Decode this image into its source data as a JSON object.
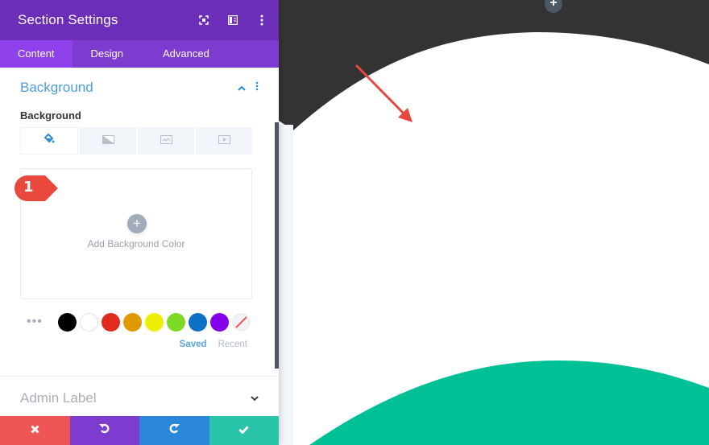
{
  "panel": {
    "title": "Section Settings",
    "header_icons": [
      "expand-icon",
      "split-view-icon",
      "more-options-icon"
    ],
    "tabs": [
      {
        "label": "Content",
        "active": true
      },
      {
        "label": "Design",
        "active": false
      },
      {
        "label": "Advanced",
        "active": false
      }
    ],
    "background_section": {
      "title": "Background",
      "field_label": "Background",
      "bg_type_tabs": [
        {
          "icon": "paint-bucket-icon",
          "active": true
        },
        {
          "icon": "gradient-icon",
          "active": false
        },
        {
          "icon": "image-icon",
          "active": false
        },
        {
          "icon": "video-icon",
          "active": false
        }
      ],
      "add_color_label": "Add Background Color",
      "callout_number": "1",
      "swatches": [
        {
          "name": "black",
          "color": "#000000"
        },
        {
          "name": "white",
          "color": "#ffffff"
        },
        {
          "name": "red",
          "color": "#e02b20"
        },
        {
          "name": "orange",
          "color": "#e09900"
        },
        {
          "name": "yellow",
          "color": "#edf000"
        },
        {
          "name": "green",
          "color": "#7cda24"
        },
        {
          "name": "blue",
          "color": "#0c71c3"
        },
        {
          "name": "purple",
          "color": "#8300e9"
        }
      ],
      "swatch_tabs": {
        "saved": "Saved",
        "recent": "Recent"
      }
    },
    "admin_section": {
      "title": "Admin Label"
    },
    "footer": {
      "discard": "discard",
      "undo": "undo",
      "redo": "redo",
      "save": "save"
    }
  },
  "canvas": {
    "top_divider_color": "#333333",
    "bottom_divider_color": "#00c096",
    "add_row_label": "+"
  },
  "colors": {
    "header_purple": "#6c2eb9",
    "tab_purple": "#7e3bd0",
    "accent_blue": "#2c8ed6",
    "discard_red": "#ef5555",
    "redo_blue": "#2b87da",
    "save_green": "#29c4a9"
  }
}
